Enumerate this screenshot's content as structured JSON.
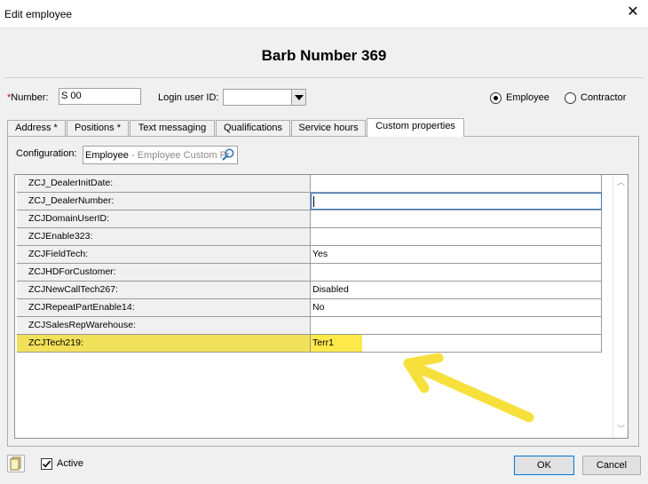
{
  "window": {
    "title": "Edit employee",
    "close_icon": "close-icon"
  },
  "heading": "Barb Number 369",
  "form": {
    "number_label": "Number:",
    "number_value": "S 00",
    "login_label": "Login user ID:",
    "login_value": "",
    "type_options": [
      {
        "label": "Employee",
        "selected": true
      },
      {
        "label": "Contractor",
        "selected": false
      }
    ]
  },
  "tabs": [
    {
      "label": "Address *",
      "active": false
    },
    {
      "label": "Positions *",
      "active": false
    },
    {
      "label": "Text messaging",
      "active": false
    },
    {
      "label": "Qualifications",
      "active": false
    },
    {
      "label": "Service hours",
      "active": false
    },
    {
      "label": "Custom properties",
      "active": true
    }
  ],
  "configuration": {
    "label": "Configuration:",
    "value": "Employee",
    "hint": " - Employee Custom Pr"
  },
  "properties": [
    {
      "name": "ZCJ_DealerInitDate:",
      "value": ""
    },
    {
      "name": "ZCJ_DealerNumber:",
      "value": ""
    },
    {
      "name": "ZCJDomainUserID:",
      "value": ""
    },
    {
      "name": "ZCJEnable323:",
      "value": ""
    },
    {
      "name": "ZCJFieldTech:",
      "value": "Yes"
    },
    {
      "name": "ZCJHDForCustomer:",
      "value": ""
    },
    {
      "name": "ZCJNewCallTech267:",
      "value": "Disabled"
    },
    {
      "name": "ZCJRepeatPartEnable14:",
      "value": "No"
    },
    {
      "name": "ZCJSalesRepWarehouse:",
      "value": ""
    },
    {
      "name": "ZCJTech219:",
      "value": "Terr1"
    }
  ],
  "highlight_color": "#ffe94a",
  "arrow_color": "#f7e03c",
  "footer": {
    "active_label": "Active",
    "active_checked": true,
    "ok_label": "OK",
    "cancel_label": "Cancel"
  }
}
